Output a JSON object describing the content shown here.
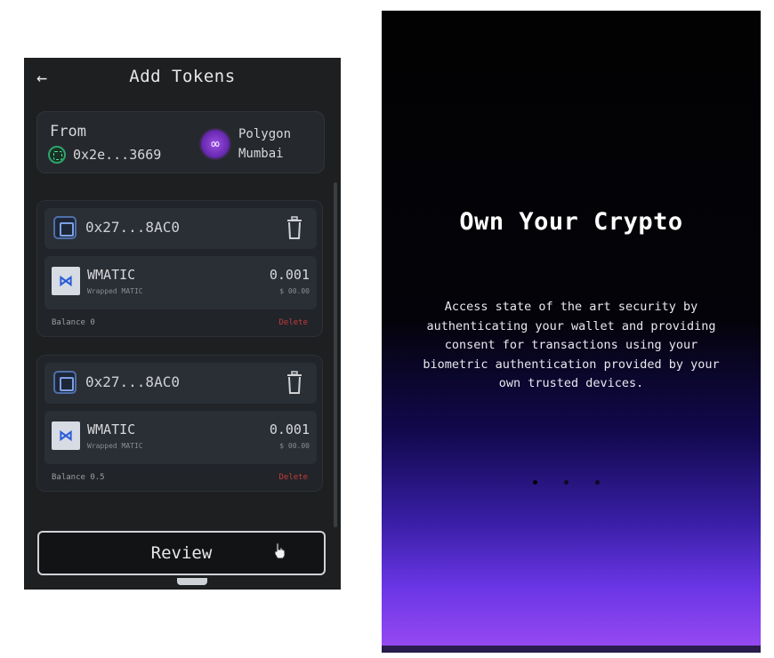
{
  "left_screen": {
    "header": {
      "back_icon": "arrow-left-icon",
      "title": "Add Tokens"
    },
    "from": {
      "label": "From",
      "address": "0x2e...3669",
      "network_line1": "Polygon",
      "network_line2": "Mumbai",
      "network_icon": "polygon-icon"
    },
    "tokens": [
      {
        "contract": "0x27...8AC0",
        "symbol": "WMATIC",
        "name": "Wrapped MATIC",
        "amount": "0.001",
        "usd": "$ 00.00",
        "balance": "Balance 0",
        "delete_label": "Delete"
      },
      {
        "contract": "0x27...8AC0",
        "symbol": "WMATIC",
        "name": "Wrapped MATIC",
        "amount": "0.001",
        "usd": "$ 00.00",
        "balance": "Balance 0.5",
        "delete_label": "Delete"
      }
    ],
    "review_label": "Review"
  },
  "right_screen": {
    "title": "Own Your Crypto",
    "description": "Access state of the art security by authenticating your wallet and providing consent for transactions using your biometric authentication provided by your own trusted devices."
  },
  "colors": {
    "left_bg": "#1e1f21",
    "card_bg": "#25292e",
    "delete_red": "#c23a3a",
    "gradient_purple": "#9a4bf2"
  }
}
